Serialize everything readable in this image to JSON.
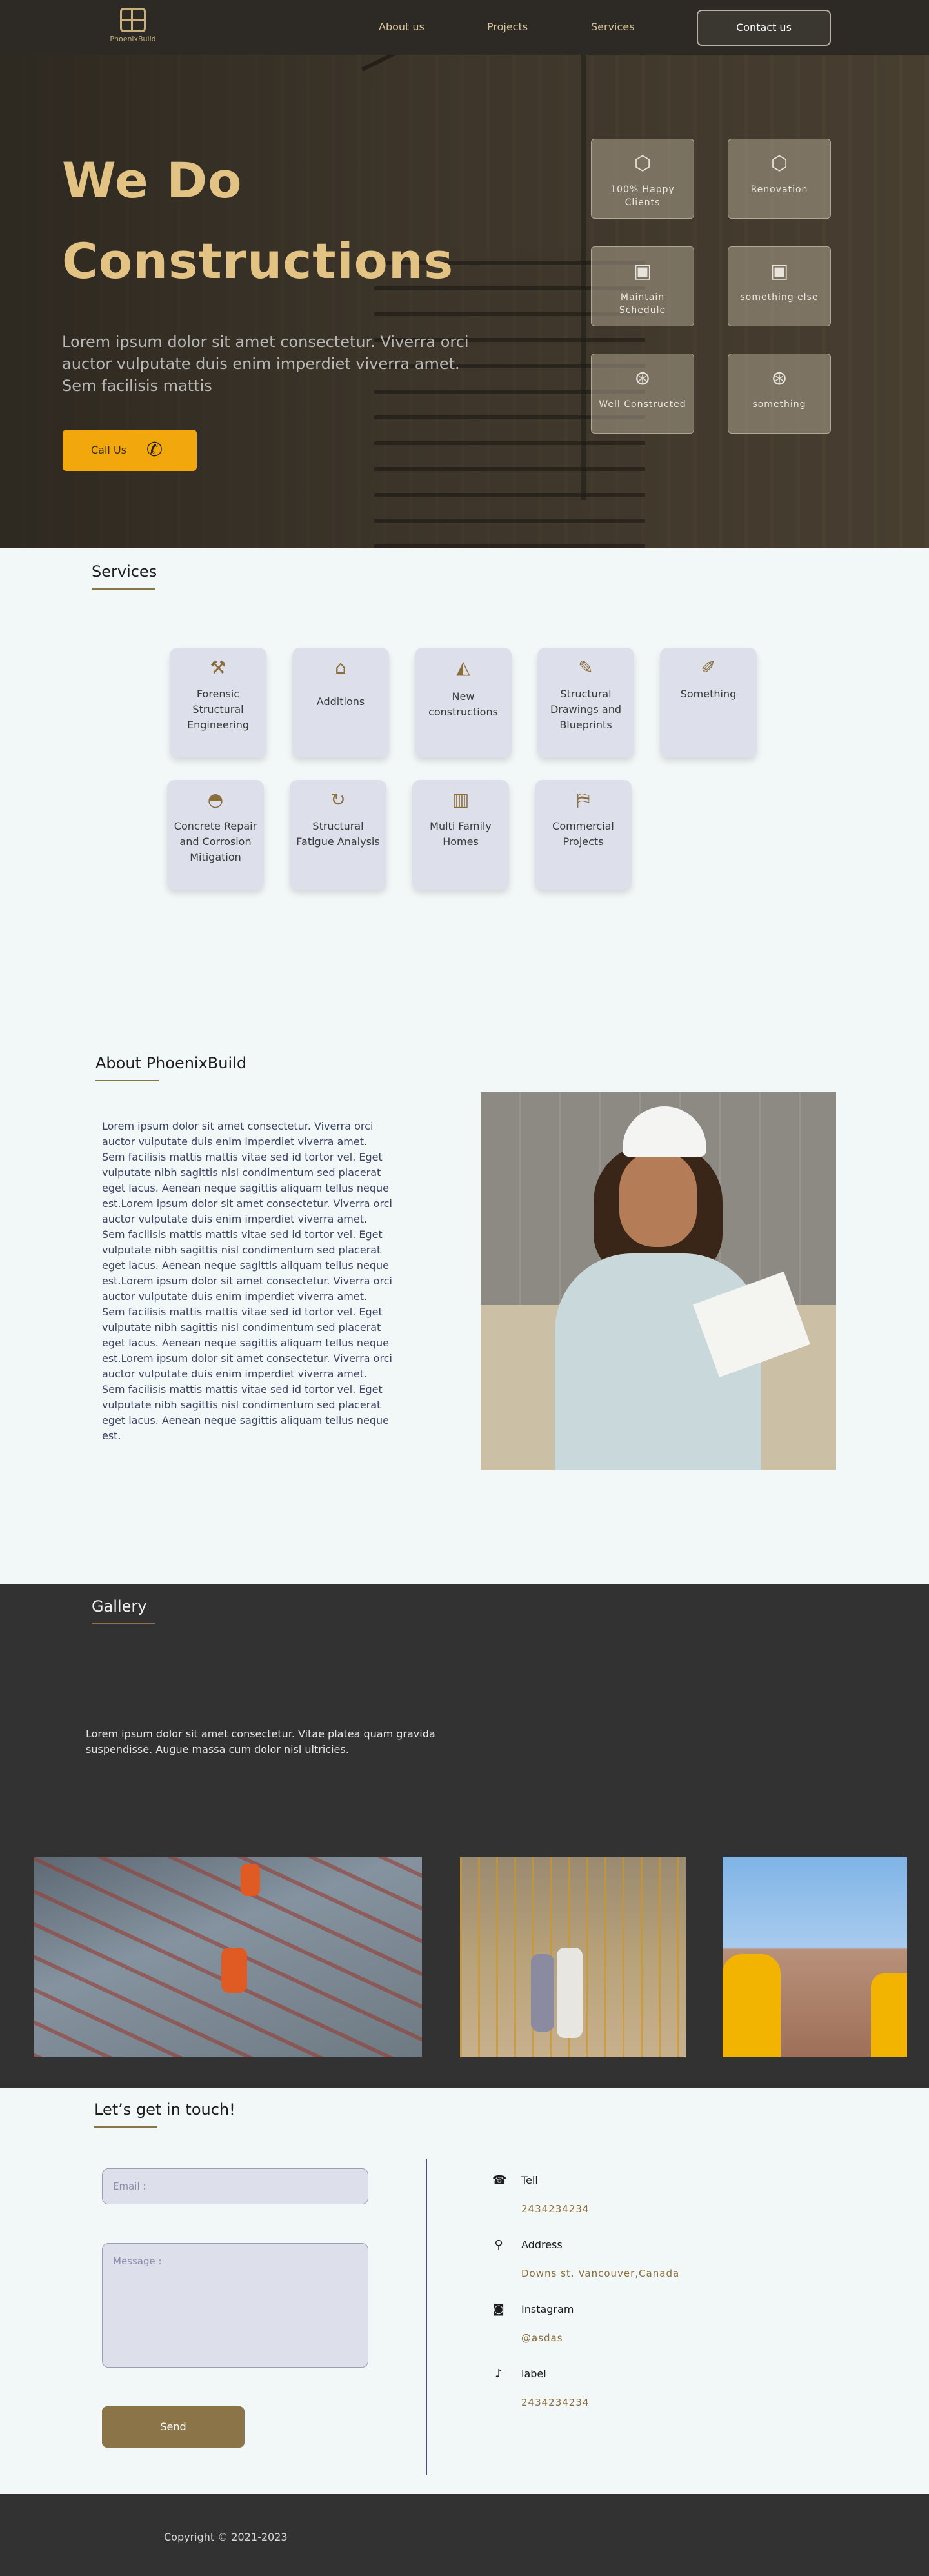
{
  "nav": {
    "logo_text": "PhoenixBuild",
    "links": [
      "About us",
      "Projects",
      "Services"
    ],
    "cta": "Contact us"
  },
  "hero": {
    "title_line1": "We Do",
    "title_line2": "Constructions",
    "subtitle": "Lorem ipsum dolor sit amet consectetur. Viverra orci auctor vulputate duis enim imperdiet viverra amet. Sem facilisis mattis",
    "call_button": "Call Us",
    "stats": [
      {
        "icon": "cube-icon",
        "label": "100% Happy Clients"
      },
      {
        "icon": "cube-icon",
        "label": "Renovation"
      },
      {
        "icon": "building-icon",
        "label": "Maintain Schedule"
      },
      {
        "icon": "building-icon",
        "label": "something else"
      },
      {
        "icon": "compass-icon",
        "label": "Well Constructed"
      },
      {
        "icon": "compass-icon",
        "label": "something"
      }
    ]
  },
  "services": {
    "heading": "Services",
    "items": [
      {
        "icon": "crane-icon",
        "label": "Forensic Structural Engineering"
      },
      {
        "icon": "house-plus-icon",
        "label": "Additions"
      },
      {
        "icon": "construction-icon",
        "label": "New constructions"
      },
      {
        "icon": "blueprint-icon",
        "label": "Structural Drawings and Blueprints"
      },
      {
        "icon": "edit-image-icon",
        "label": "Something"
      },
      {
        "icon": "hardhat-icon",
        "label": "Concrete Repair and Corrosion Mitigation"
      },
      {
        "icon": "cycle-icon",
        "label": "Structural Fatigue Analysis"
      },
      {
        "icon": "apartments-icon",
        "label": "Multi Family Homes"
      },
      {
        "icon": "map-dollar-icon",
        "label": "Commercial Projects"
      }
    ]
  },
  "about": {
    "heading": "About PhoenixBuild",
    "body": "Lorem ipsum dolor sit amet consectetur. Viverra orci auctor vulputate duis enim imperdiet viverra amet. Sem facilisis mattis mattis vitae sed id tortor vel. Eget vulputate nibh sagittis nisl condimentum sed placerat eget lacus. Aenean neque sagittis aliquam tellus neque est.Lorem ipsum dolor sit amet consectetur. Viverra orci auctor vulputate duis enim imperdiet viverra amet. Sem facilisis mattis mattis vitae sed id tortor vel. Eget vulputate nibh sagittis nisl condimentum sed placerat eget lacus. Aenean neque sagittis aliquam tellus neque est.Lorem ipsum dolor sit amet consectetur. Viverra orci auctor vulputate duis enim imperdiet viverra amet. Sem facilisis mattis mattis vitae sed id tortor vel. Eget vulputate nibh sagittis nisl condimentum sed placerat eget lacus. Aenean neque sagittis aliquam tellus neque est.Lorem ipsum dolor sit amet consectetur. Viverra orci auctor vulputate duis enim imperdiet viverra amet. Sem facilisis mattis mattis vitae sed id tortor vel. Eget vulputate nibh sagittis nisl condimentum sed placerat eget lacus. Aenean neque sagittis aliquam tellus neque est."
  },
  "gallery": {
    "heading": "Gallery",
    "text": "Lorem ipsum dolor sit amet consectetur. Vitae platea quam gravida suspendisse. Augue massa cum dolor nisl ultricies."
  },
  "contact": {
    "heading": "Let’s get in touch!",
    "email_placeholder": "Email :",
    "message_placeholder": "Message :",
    "send": "Send",
    "items": [
      {
        "icon": "phone-icon",
        "label": "Tell",
        "value": "2434234234"
      },
      {
        "icon": "location-pin-icon",
        "label": "Address",
        "value": "Downs st. Vancouver,Canada"
      },
      {
        "icon": "instagram-icon",
        "label": "Instagram",
        "value": "@asdas"
      },
      {
        "icon": "tiktok-icon",
        "label": "label",
        "value": "2434234234"
      }
    ]
  },
  "footer": {
    "copyright": "Copyright © 2021-2023"
  }
}
